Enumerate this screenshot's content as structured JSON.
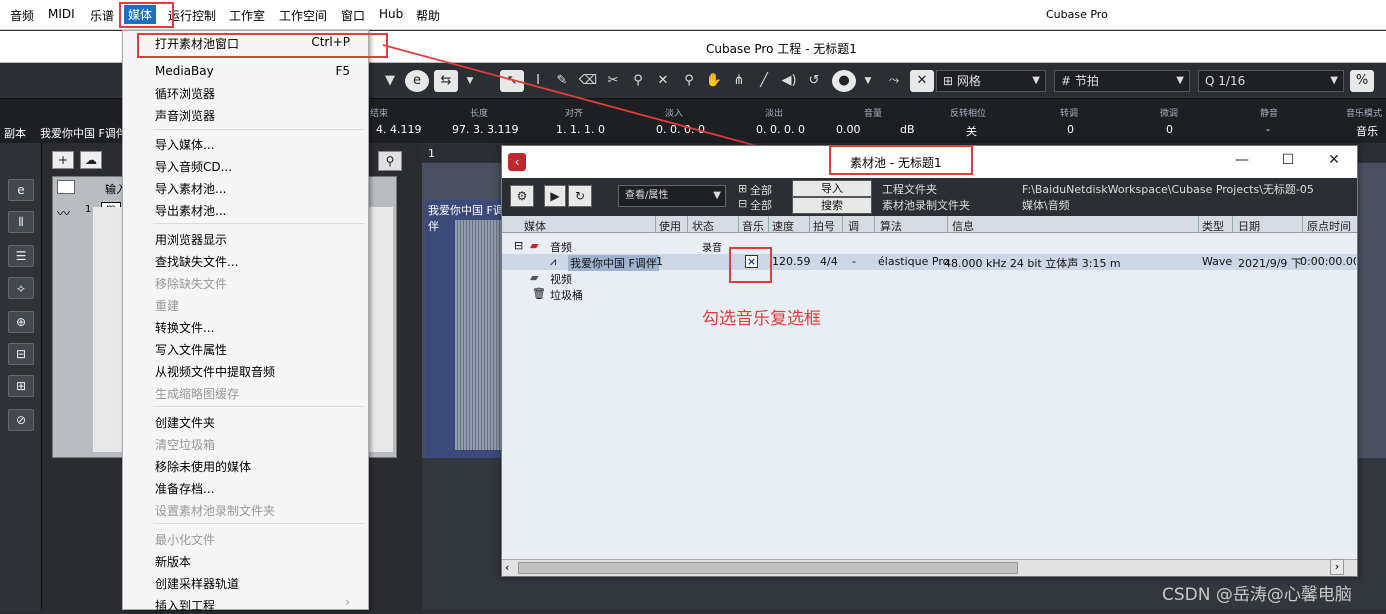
{
  "menubar": {
    "items": [
      "音频",
      "MIDI",
      "乐谱",
      "媒体",
      "运行控制",
      "工作室",
      "工作空间",
      "窗口",
      "Hub",
      "帮助"
    ],
    "app_title": "Cubase Pro"
  },
  "project_title": "Cubase Pro 工程 - 无标题1",
  "toolbar": {
    "snap_label": "网格",
    "grid_label": "节拍",
    "quantize_label": "1/16"
  },
  "infoline": {
    "headers": [
      "结束",
      "长度",
      "对齐",
      "淡入",
      "淡出",
      "音量",
      "反转相位",
      "转调",
      "微调",
      "静音",
      "音乐模式"
    ],
    "values": [
      "4. 4.119",
      "97. 3. 3.119",
      "1. 1. 1.  0",
      "0. 0. 0.  0",
      "0. 0. 0.  0",
      "0.00",
      "dB",
      "关",
      "0",
      "0",
      "-",
      "音乐"
    ],
    "left_label": "副本",
    "left_value": "我爱你中国 F调伴"
  },
  "track": {
    "header_label": "输入",
    "track_number": "1",
    "event_label": "我爱你中国 F调伴"
  },
  "media_menu": {
    "items": [
      {
        "label": "打开素材池窗口",
        "shortcut": "Ctrl+P",
        "disabled": false
      },
      {
        "label": "MediaBay",
        "shortcut": "F5",
        "disabled": false
      },
      {
        "label": "循环浏览器",
        "shortcut": "",
        "disabled": false
      },
      {
        "label": "声音浏览器",
        "shortcut": "",
        "disabled": false
      },
      {
        "label": "导入媒体...",
        "shortcut": "",
        "disabled": false
      },
      {
        "label": "导入音频CD...",
        "shortcut": "",
        "disabled": false
      },
      {
        "label": "导入素材池...",
        "shortcut": "",
        "disabled": false
      },
      {
        "label": "导出素材池...",
        "shortcut": "",
        "disabled": false
      },
      {
        "label": "用浏览器显示",
        "shortcut": "",
        "disabled": false
      },
      {
        "label": "查找缺失文件...",
        "shortcut": "",
        "disabled": false
      },
      {
        "label": "移除缺失文件",
        "shortcut": "",
        "disabled": true
      },
      {
        "label": "重建",
        "shortcut": "",
        "disabled": true
      },
      {
        "label": "转换文件...",
        "shortcut": "",
        "disabled": false
      },
      {
        "label": "写入文件属性",
        "shortcut": "",
        "disabled": false
      },
      {
        "label": "从视频文件中提取音频",
        "shortcut": "",
        "disabled": false
      },
      {
        "label": "生成缩略图缓存",
        "shortcut": "",
        "disabled": true
      },
      {
        "label": "创建文件夹",
        "shortcut": "",
        "disabled": false
      },
      {
        "label": "清空垃圾箱",
        "shortcut": "",
        "disabled": true
      },
      {
        "label": "移除未使用的媒体",
        "shortcut": "",
        "disabled": false
      },
      {
        "label": "准备存档...",
        "shortcut": "",
        "disabled": false
      },
      {
        "label": "设置素材池录制文件夹",
        "shortcut": "",
        "disabled": true
      },
      {
        "label": "最小化文件",
        "shortcut": "",
        "disabled": true
      },
      {
        "label": "新版本",
        "shortcut": "",
        "disabled": false
      },
      {
        "label": "创建采样器轨道",
        "shortcut": "",
        "disabled": false
      },
      {
        "label": "插入到工程",
        "shortcut": "›",
        "disabled": false
      }
    ]
  },
  "pool": {
    "title": "素材池 - 无标题1",
    "view_select": "查看/属性",
    "all_label_1": "全部",
    "all_label_2": "全部",
    "import_button": "导入",
    "search_button": "搜索",
    "project_folder_label": "工程文件夹",
    "record_folder_label": "素材池录制文件夹",
    "project_folder_path": "F:\\BaiduNetdiskWorkspace\\Cubase Projects\\无标题-05",
    "record_folder_path": "媒体\\音频",
    "columns": [
      "媒体",
      "使用",
      "状态",
      "音乐",
      "速度",
      "拍号",
      "调",
      "算法",
      "信息",
      "类型",
      "日期",
      "原点时间"
    ],
    "folders": {
      "audio": "音频",
      "record_tag": "录音",
      "video": "视频",
      "trash": "垃圾桶"
    },
    "file_row": {
      "name": "我爱你中国 F调伴",
      "used": "1",
      "music_checked": true,
      "music_mark": "×",
      "tempo": "120.59",
      "signature": "4/4",
      "key": "-",
      "algorithm": "élastique Pro",
      "info": "48.000 kHz  24 bit  立体声   3:15 m",
      "type": "Wave",
      "date": "2021/9/9  下",
      "origin": "0:00:00.000"
    }
  },
  "annotation": "勾选音乐复选框",
  "watermark": "CSDN @岳涛@心馨电脑",
  "colors": {
    "highlight_red": "#e43b3b",
    "menu_active_blue": "#1f6fbf",
    "dark_bg": "#2b2e33"
  }
}
